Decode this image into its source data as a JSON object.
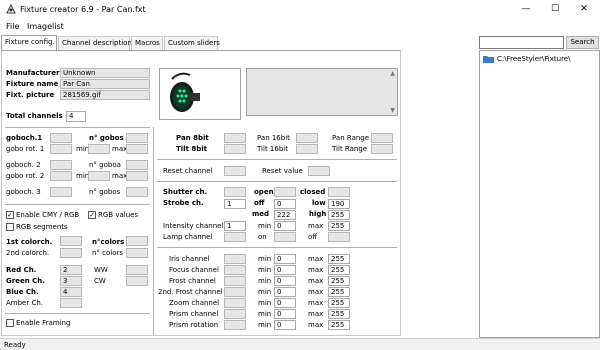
{
  "window": {
    "title": "Fixture creator 6.9 - Par Can.fxt",
    "minimize": "—",
    "maximize": "☐",
    "close": "✕"
  },
  "menu": {
    "file": "File",
    "imagelist": "Imagelist"
  },
  "tabs": [
    "Fixture config.",
    "Channel description",
    "Macros",
    "Custom sliders"
  ],
  "search": {
    "value": "",
    "button": "Search"
  },
  "tree": {
    "root": "C:\\FreeStyler\\Fixture\\"
  },
  "status": "Ready",
  "fixture": {
    "manufacturer_label": "Manufacturer",
    "manufacturer": "Unknown",
    "name_label": "Fixture name",
    "name": "Par Can",
    "picture_label": "Fixt. picture",
    "picture": "281569.gif",
    "total_label": "Total channels",
    "total": "4"
  },
  "gobo": {
    "goboch1": "goboch.1",
    "ngobos1": "n° gobos",
    "gobo_rot1": "gobo rot. 1",
    "min": "min",
    "max": "max",
    "goboch2": "goboch. 2",
    "ngoboa": "n° goboa",
    "gobo_rot2": "gobo rot. 2",
    "goboch3": "goboch. 3",
    "ngobos3": "n° gobos"
  },
  "color": {
    "enable_cmy": "Enable CMY / RGB",
    "rgb_values": "RGB values",
    "rgb_segments": "RGB segments",
    "colorch1": "1st colorch.",
    "ncolors": "n°colors",
    "colorch2": "2nd colorch.",
    "ncolors2": "n° colors",
    "red": "Red Ch.",
    "red_val": "2",
    "green": "Green Ch.",
    "green_val": "3",
    "blue": "Blue Ch.",
    "blue_val": "4",
    "amber": "Amber Ch.",
    "ww": "WW",
    "cw": "CW",
    "enable_framing": "Enable Framing"
  },
  "pantilt": {
    "pan8": "Pan 8bit",
    "tilt8": "Tilt 8bit",
    "pan16": "Pan 16bit",
    "tilt16": "Tilt 16bit",
    "panrange": "Pan Range",
    "tiltrange": "Tilt Range"
  },
  "reset": {
    "channel": "Reset channel",
    "value": "Reset value"
  },
  "shutter": {
    "shutter": "Shutter ch.",
    "strobe": "Strobe ch.",
    "strobe_val": "1",
    "open": "open",
    "closed": "closed",
    "off": "off",
    "off_val": "0",
    "low": "low",
    "low_val": "190",
    "med": "med",
    "med_val": "222",
    "high": "high",
    "high_val": "255",
    "intensity": "Intensity channel",
    "intensity_val": "1",
    "min": "min",
    "min_val": "0",
    "max": "max",
    "max_val": "255",
    "lamp": "Lamp channel",
    "on": "on",
    "lamp_off": "off"
  },
  "channels": [
    {
      "label": "Iris channel",
      "min": "0",
      "max": "255"
    },
    {
      "label": "Focus channel",
      "min": "0",
      "max": "255"
    },
    {
      "label": "Frost channel",
      "min": "0",
      "max": "255"
    },
    {
      "label": "2nd. Frost channel",
      "min": "0",
      "max": "255"
    },
    {
      "label": "Zoom channel",
      "min": "0",
      "max": "255"
    },
    {
      "label": "Prism channel",
      "min": "0",
      "max": "255"
    },
    {
      "label": "Prism rotation",
      "min": "0",
      "max": "255"
    }
  ],
  "channel_min_label": "min",
  "channel_max_label": "max",
  "checked_mark": "✓"
}
